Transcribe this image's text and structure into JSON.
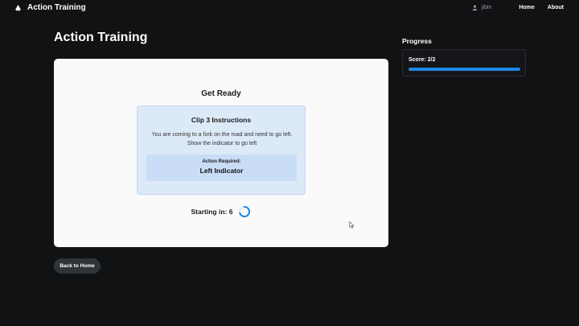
{
  "app": {
    "brand_title": "Action Training",
    "brand_icon": "app-logo-icon"
  },
  "nav": {
    "user_name": "jibin",
    "home_label": "Home",
    "about_label": "About"
  },
  "page": {
    "title": "Action Training"
  },
  "card": {
    "heading": "Get Ready",
    "clip_title": "Clip 3 Instructions",
    "instruction": "You are coming to a fork on the road and need to go left. Show the indicator to go left",
    "action_label": "Action Required:",
    "action_value": "Left Indicator",
    "countdown_label": "Starting in:",
    "countdown_value": "6"
  },
  "progress": {
    "heading": "Progress",
    "score_text": "Score: 2/2",
    "fraction": 1.0
  },
  "buttons": {
    "back_label": "Back to Home"
  },
  "colors": {
    "background": "#111214",
    "card": "#fafafa",
    "instructions_bg": "#dce9f7",
    "action_bg": "#c9ddf6",
    "accent": "#1e88e5",
    "back_button": "#2e3437"
  }
}
